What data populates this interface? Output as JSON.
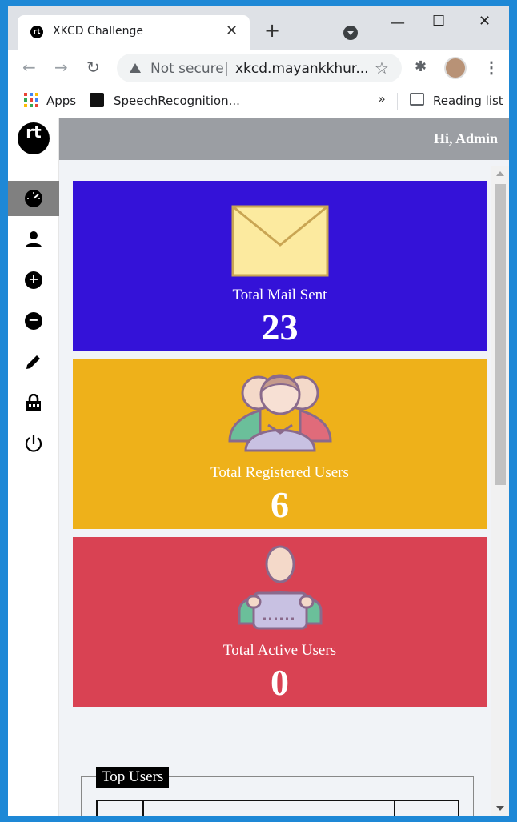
{
  "browser": {
    "tab_title": "XKCD Challenge",
    "tab_favicon": "rt",
    "close_tab": "✕",
    "new_tab": "+",
    "omnibox_security": "Not secure",
    "omnibox_divider": "|",
    "omnibox_url": "xkcd.mayankkhur...",
    "bookmarks": {
      "apps": "Apps",
      "speech": "SpeechRecognition...",
      "more": "»",
      "reading_list": "Reading list"
    }
  },
  "app": {
    "logo": "rt",
    "greeting": "Hi, Admin",
    "sidebar_icons": [
      "dashboard-icon",
      "user-icon",
      "add-icon",
      "remove-icon",
      "edit-icon",
      "lock-icon",
      "logout-icon"
    ]
  },
  "cards": [
    {
      "label": "Total Mail Sent",
      "value": "23",
      "color": "#3412d8"
    },
    {
      "label": "Total Registered Users",
      "value": "6",
      "color": "#eeb11a"
    },
    {
      "label": "Total Active Users",
      "value": "0",
      "color": "#d94253"
    }
  ],
  "top_users": {
    "legend": "Top Users"
  }
}
